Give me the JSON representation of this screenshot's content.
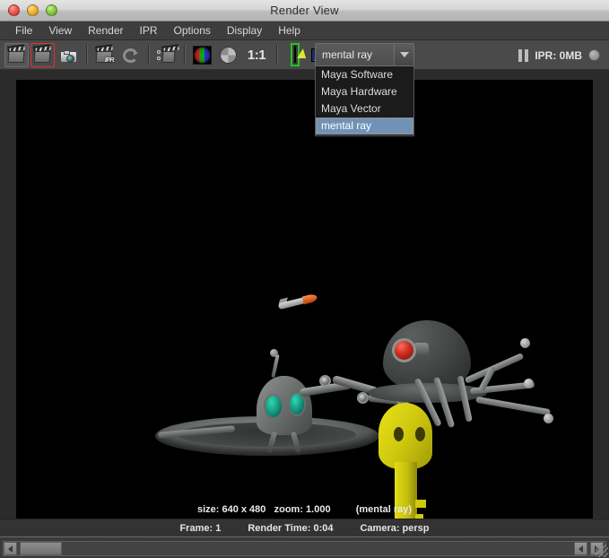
{
  "window": {
    "title": "Render View",
    "controls": [
      "close",
      "minimize",
      "zoom"
    ]
  },
  "menubar": {
    "items": [
      {
        "label": "File"
      },
      {
        "label": "View"
      },
      {
        "label": "Render"
      },
      {
        "label": "IPR"
      },
      {
        "label": "Options"
      },
      {
        "label": "Display"
      },
      {
        "label": "Help"
      }
    ]
  },
  "toolbar": {
    "buttons": [
      {
        "name": "render-current-frame",
        "icon": "clapboard-icon"
      },
      {
        "name": "redo-previous-render",
        "icon": "clapboard-region-icon",
        "selected": true
      },
      {
        "name": "render-region-snapshot",
        "icon": "camera-icon"
      },
      {
        "name": "ipr-render",
        "icon": "clapboard-ipr-icon"
      },
      {
        "name": "refresh-ipr-image",
        "icon": "refresh-icon"
      },
      {
        "name": "render-settings",
        "icon": "clapboard-options-icon"
      },
      {
        "name": "display-rgb-channels",
        "icon": "rgb-sphere-icon"
      },
      {
        "name": "display-alpha-channel",
        "icon": "alpha-sphere-icon"
      },
      {
        "name": "actual-size",
        "icon": "one-to-one-label",
        "label": "1:1"
      },
      {
        "name": "keep-image",
        "icon": "keep-image-icon"
      },
      {
        "name": "remove-image",
        "icon": "remove-image-icon"
      },
      {
        "name": "display-render-settings",
        "icon": "snapshot-icon"
      }
    ],
    "one_to_one_label": "1:1"
  },
  "renderer_combo": {
    "name": "render-engine-select",
    "value": "mental ray",
    "expanded": true,
    "options": [
      {
        "label": "Maya Software",
        "selected": false
      },
      {
        "label": "Maya Hardware",
        "selected": false
      },
      {
        "label": "Maya Vector",
        "selected": false
      },
      {
        "label": "mental ray",
        "selected": true
      }
    ]
  },
  "ipr_status": {
    "pause_icon": "pause-icon",
    "label": "IPR: 0MB",
    "led": "ipr-activity-led"
  },
  "canvas": {
    "info": {
      "size": "size: 640 x 480",
      "zoom": "zoom: 1.000",
      "renderer": "(mental ray)"
    },
    "scene_description": "3D render of small green-eyed robot sitting in a metal dish beside a large dark spider-like robot with a red eye, a yellow key in the foreground and an orange-tipped rocket in the upper background"
  },
  "statusbar": {
    "frame": "Frame: 1",
    "render_time": "Render Time: 0:04",
    "camera": "Camera: persp"
  },
  "scrollbar": {
    "left_arrow": "scroll-left-arrow",
    "right_arrow": "scroll-right-arrow",
    "thumb": "scroll-thumb"
  },
  "colors": {
    "titlebar_top": "#e4e4e4",
    "menubar": "#3d3d3d",
    "toolbar": "#4a4a4a",
    "canvas": "#000000",
    "highlight_blue": "#6f92b8",
    "selection_red": "#e03030",
    "keep_green": "#23c423"
  }
}
